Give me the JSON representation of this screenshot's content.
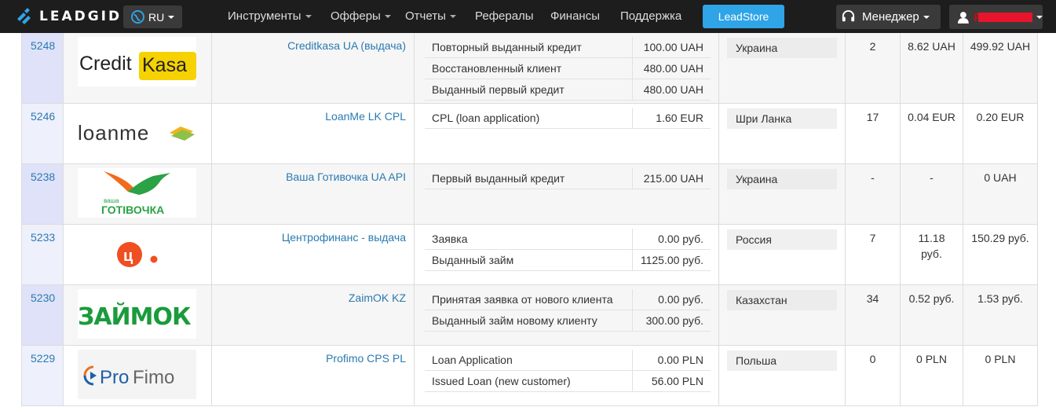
{
  "brand": {
    "name": "LEADGID"
  },
  "lang": {
    "label": "RU"
  },
  "nav": {
    "items": [
      {
        "label": "Инструменты",
        "dropdown": true
      },
      {
        "label": "Офферы",
        "dropdown": true
      },
      {
        "label": "Отчеты",
        "dropdown": true
      },
      {
        "label": "Рефералы",
        "dropdown": false
      },
      {
        "label": "Финансы",
        "dropdown": false
      },
      {
        "label": "Поддержка",
        "dropdown": false
      }
    ],
    "leadstore": "LeadStore",
    "manager": "Менеджер",
    "user": "Р"
  },
  "colors": {
    "navbar": "#1d1d1d",
    "accent": "#2fa4e7",
    "link": "#2a7ab0"
  },
  "rows": [
    {
      "id": "5248",
      "logo": "Credit Kasa",
      "name": "Creditkasa UA (выдача)",
      "goals": [
        {
          "name": "Повторный выданный кредит",
          "value": "100.00 UAH"
        },
        {
          "name": "Восстановленный клиент",
          "value": "480.00 UAH"
        },
        {
          "name": "Выданный первый кредит",
          "value": "480.00 UAH"
        }
      ],
      "geo": "Украина",
      "s1": "2",
      "s2": "8.62 UAH",
      "s3": "499.92 UAH"
    },
    {
      "id": "5246",
      "logo": "loanme",
      "name": "LoanMe LK CPL",
      "goals": [
        {
          "name": "CPL (loan application)",
          "value": "1.60 EUR"
        }
      ],
      "geo": "Шри Ланка",
      "s1": "17",
      "s2": "0.04 EUR",
      "s3": "0.20 EUR"
    },
    {
      "id": "5238",
      "logo": "ваша готівочка",
      "name": "Ваша Готивочка UA API",
      "goals": [
        {
          "name": "Первый выданный кредит",
          "value": "215.00 UAH"
        }
      ],
      "geo": "Украина",
      "s1": "-",
      "s2": "-",
      "s3": "0 UAH"
    },
    {
      "id": "5233",
      "logo": "ц",
      "name": "Центрофинанс - выдача",
      "goals": [
        {
          "name": "Заявка",
          "value": "0.00 руб."
        },
        {
          "name": "Выданный займ",
          "value": "1125.00 руб."
        }
      ],
      "geo": "Россия",
      "s1": "7",
      "s2": "11.18 руб.",
      "s3": "150.29 руб."
    },
    {
      "id": "5230",
      "logo": "ЗАЙМОК",
      "name": "ZaimOK KZ",
      "goals": [
        {
          "name": "Принятая заявка от нового клиента",
          "value": "0.00 руб."
        },
        {
          "name": "Выданный займ новому клиенту",
          "value": "300.00 руб."
        }
      ],
      "geo": "Казахстан",
      "s1": "34",
      "s2": "0.52 руб.",
      "s3": "1.53 руб."
    },
    {
      "id": "5229",
      "logo": "ProFimo",
      "name": "Profimo CPS PL",
      "goals": [
        {
          "name": "Loan Application",
          "value": "0.00 PLN"
        },
        {
          "name": "Issued Loan (new customer)",
          "value": "56.00 PLN"
        }
      ],
      "geo": "Польша",
      "s1": "0",
      "s2": "0 PLN",
      "s3": "0 PLN"
    }
  ]
}
